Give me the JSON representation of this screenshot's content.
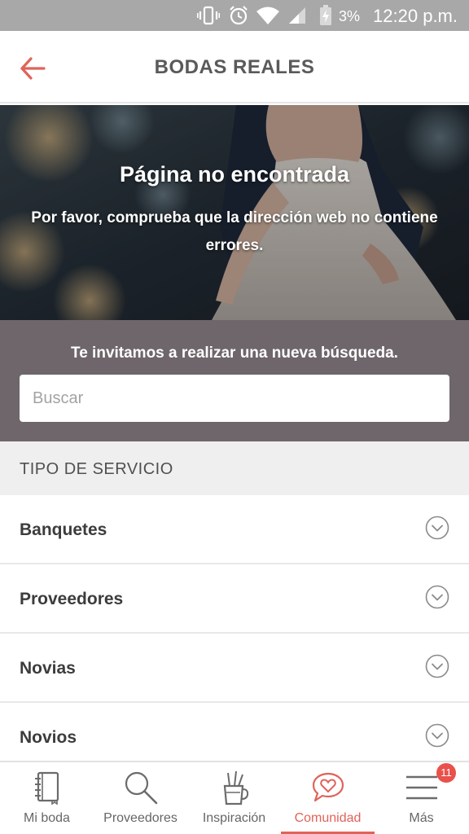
{
  "status_bar": {
    "battery": "3%",
    "time": "12:20 p.m."
  },
  "header": {
    "title": "BODAS REALES"
  },
  "hero": {
    "title": "Página no encontrada",
    "message": "Por favor, comprueba que la dirección web no contiene errores."
  },
  "search": {
    "prompt": "Te invitamos a realizar una nueva búsqueda.",
    "placeholder": "Buscar",
    "value": ""
  },
  "service_section": {
    "title": "TIPO DE SERVICIO",
    "items": [
      {
        "label": "Banquetes"
      },
      {
        "label": "Proveedores"
      },
      {
        "label": "Novias"
      },
      {
        "label": "Novios"
      }
    ]
  },
  "bottom_nav": {
    "items": [
      {
        "label": "Mi boda",
        "icon": "notebook-icon"
      },
      {
        "label": "Proveedores",
        "icon": "search-icon"
      },
      {
        "label": "Inspiración",
        "icon": "pencil-cup-icon"
      },
      {
        "label": "Comunidad",
        "icon": "heart-chat-icon",
        "active": true
      },
      {
        "label": "Más",
        "icon": "menu-icon",
        "badge": "11"
      }
    ]
  },
  "colors": {
    "accent": "#e0635a",
    "status_bar": "#a8a8a8",
    "search_panel": "#6e666b"
  }
}
